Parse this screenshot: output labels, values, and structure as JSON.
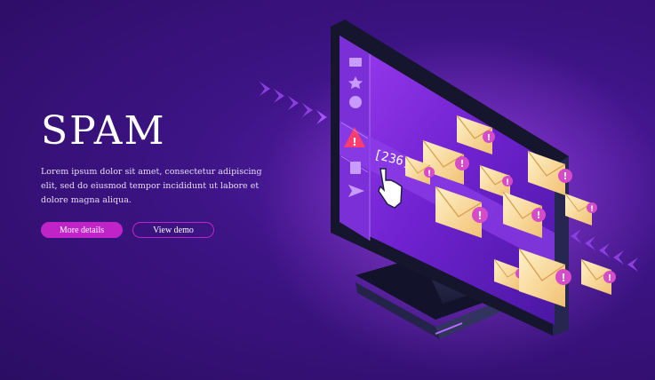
{
  "hero": {
    "title": "SPAM",
    "description": "Lorem ipsum dolor sit amet, consectetur adipiscing elit, sed do eiusmod tempor incididunt ut labore et dolore magna aliqua."
  },
  "buttons": {
    "primary_label": "More details",
    "secondary_label": "View demo"
  },
  "screen": {
    "spam_count": "[236]",
    "sidebar_icons": [
      "mail-icon",
      "star-icon",
      "clock-icon",
      "warning-icon",
      "trash-icon",
      "send-icon"
    ]
  },
  "colors": {
    "background": "#3e1486",
    "accent": "#c024c9",
    "envelope": "#f6d48a",
    "alert_badge": "#d64bc8"
  }
}
